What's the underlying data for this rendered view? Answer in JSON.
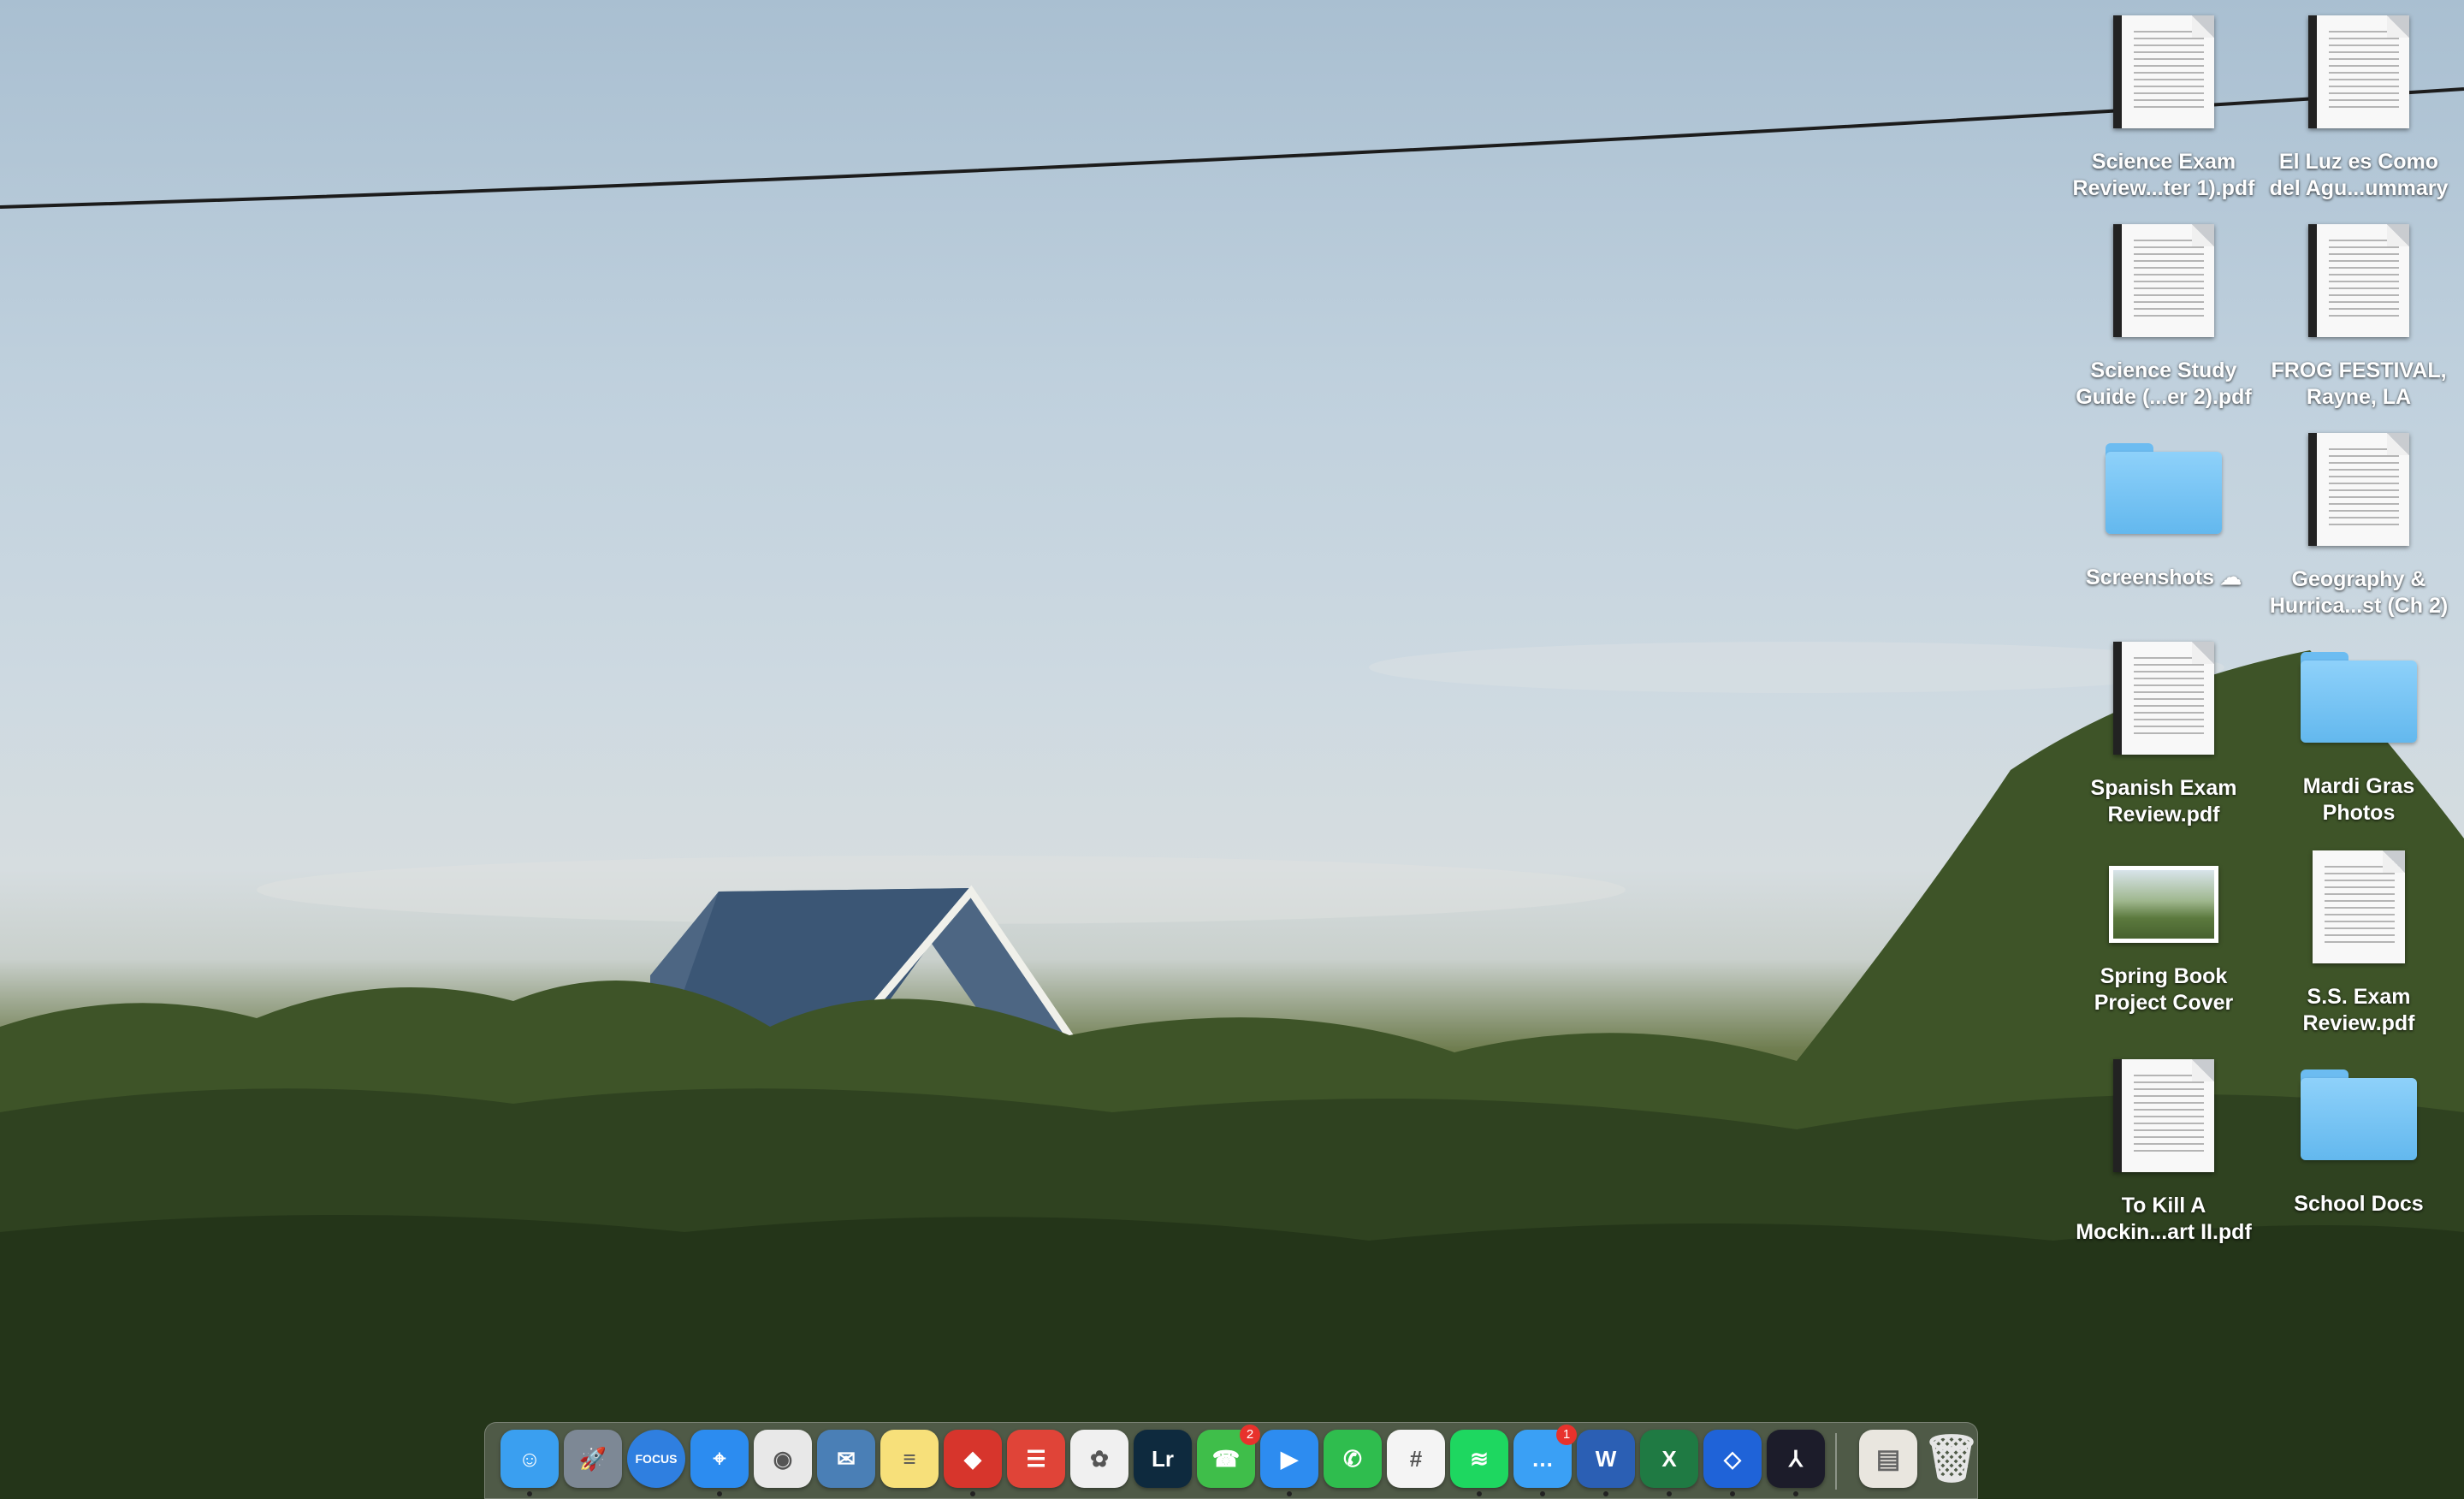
{
  "desktop": {
    "icons": [
      {
        "label_line1": "Science Exam",
        "label_line2": "Review...ter 1).pdf",
        "type": "pdf-document"
      },
      {
        "label_line1": "El Luz es Como",
        "label_line2": "del Agu...ummary",
        "type": "document"
      },
      {
        "label_line1": "Science Study",
        "label_line2": "Guide (...er 2).pdf",
        "type": "pdf-document"
      },
      {
        "label_line1": "FROG FESTIVAL,",
        "label_line2": "Rayne, LA",
        "type": "document"
      },
      {
        "label_line1": "Screenshots",
        "label_line2": "",
        "type": "folder",
        "cloud_glyph": "☁"
      },
      {
        "label_line1": "Geography &",
        "label_line2": "Hurrica...st (Ch 2)",
        "type": "document"
      },
      {
        "label_line1": "Spanish Exam",
        "label_line2": "Review.pdf",
        "type": "pdf-document"
      },
      {
        "label_line1": "Mardi Gras",
        "label_line2": "Photos",
        "type": "folder"
      },
      {
        "label_line1": "Spring Book",
        "label_line2": "Project Cover",
        "type": "image"
      },
      {
        "label_line1": "S.S. Exam",
        "label_line2": "Review.pdf",
        "type": "pdf-document"
      },
      {
        "label_line1": "To Kill A",
        "label_line2": "Mockin...art II.pdf",
        "type": "pdf-document"
      },
      {
        "label_line1": "School Docs",
        "label_line2": "",
        "type": "folder"
      }
    ]
  },
  "dock": {
    "apps": [
      {
        "name": "Finder",
        "icon": "finder-icon",
        "color": "#3a9ff0",
        "glyph": "☺",
        "running": true
      },
      {
        "name": "Launchpad",
        "icon": "rocket-icon",
        "color": "#7d8895",
        "glyph": "🚀",
        "running": false
      },
      {
        "name": "Focus",
        "icon": "focus-icon",
        "color": "#2f7fe0",
        "glyph": "FOCUS",
        "running": false
      },
      {
        "name": "Safari",
        "icon": "compass-icon",
        "color": "#2c8cf0",
        "glyph": "⌖",
        "running": true
      },
      {
        "name": "Chrome",
        "icon": "chrome-icon",
        "color": "#e8e8e8",
        "glyph": "◉",
        "running": false
      },
      {
        "name": "Preview",
        "icon": "preview-icon",
        "color": "#4a7fb6",
        "glyph": "✉",
        "running": false
      },
      {
        "name": "Notes",
        "icon": "notes-icon",
        "color": "#f7e07a",
        "glyph": "≡",
        "running": false
      },
      {
        "name": "Reeder",
        "icon": "reeder-icon",
        "color": "#d7352c",
        "glyph": "◆",
        "running": true
      },
      {
        "name": "Todoist",
        "icon": "todoist-icon",
        "color": "#e04438",
        "glyph": "☰",
        "running": false
      },
      {
        "name": "Photos",
        "icon": "photos-icon",
        "color": "#f0f0f0",
        "glyph": "✿",
        "running": false
      },
      {
        "name": "Lightroom",
        "icon": "lightroom-icon",
        "color": "#0e2a3e",
        "glyph": "Lr",
        "running": false
      },
      {
        "name": "FaceTime",
        "icon": "facetime-icon",
        "color": "#3fbe4a",
        "glyph": "☎",
        "running": false,
        "badge": "2"
      },
      {
        "name": "Zoom",
        "icon": "zoom-icon",
        "color": "#2d8cf0",
        "glyph": "▶",
        "running": true
      },
      {
        "name": "WhatsApp",
        "icon": "whatsapp-icon",
        "color": "#2fbd4e",
        "glyph": "✆",
        "running": false
      },
      {
        "name": "Slack",
        "icon": "slack-icon",
        "color": "#f4f4f4",
        "glyph": "#",
        "running": false
      },
      {
        "name": "Spotify",
        "icon": "spotify-icon",
        "color": "#1ed760",
        "glyph": "≋",
        "running": true
      },
      {
        "name": "Messenger",
        "icon": "messenger-icon",
        "color": "#3aa0f5",
        "glyph": "…",
        "running": true,
        "badge": "1"
      },
      {
        "name": "Word",
        "icon": "word-icon",
        "color": "#2b5fb4",
        "glyph": "W",
        "running": true
      },
      {
        "name": "Excel",
        "icon": "excel-icon",
        "color": "#1f7a43",
        "glyph": "X",
        "running": true
      },
      {
        "name": "Dropbox",
        "icon": "dropbox-icon",
        "color": "#1f63d8",
        "glyph": "◇",
        "running": true
      },
      {
        "name": "Acrobat",
        "icon": "acrobat-icon",
        "color": "#1c1c2a",
        "glyph": "⅄",
        "running": true
      }
    ],
    "trailing": [
      {
        "name": "Documents stack",
        "icon": "documents-stack-icon"
      },
      {
        "name": "Trash",
        "icon": "trash-icon"
      }
    ]
  }
}
